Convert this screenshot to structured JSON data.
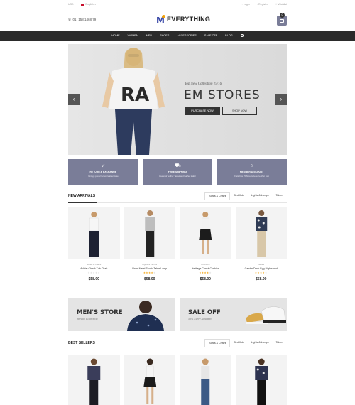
{
  "topbar": {
    "currency": "USD",
    "language": "English",
    "login": "Login",
    "register": "Register",
    "wishlist": "Wishlist"
  },
  "header": {
    "phone": "(01) 158 1468 79",
    "logo_text": "EVERYTHING",
    "cart_count": "0"
  },
  "nav": {
    "items": [
      "HOME",
      "WOMEN",
      "MEN",
      "SHOES",
      "ACCESSORIES",
      "SALE OFF",
      "BLOG"
    ]
  },
  "hero": {
    "tagline": "Top New Collection 15/16",
    "title": "EM STORES",
    "purchase_label": "PURCHASE NOW",
    "shop_label": "SHOP NOW"
  },
  "features": [
    {
      "icon": "rocket-icon",
      "title": "RETURN & EXCHANGE",
      "desc": "Vintage pastel lectum leather case"
    },
    {
      "icon": "car-icon",
      "title": "FREE SHIPPING",
      "desc": "Loafer of leather Tassel and leather loafer"
    },
    {
      "icon": "gift-icon",
      "title": "MEMBER DISCOUNT",
      "desc": "Flats Cus 25 Alina fathered leather loan"
    }
  ],
  "new_arrivals": {
    "title": "NEW ARRIVALS",
    "tabs": [
      "Sofas & Chairs",
      "Bed Kids",
      "Lights & Lamps",
      "Tables"
    ],
    "products": [
      {
        "category": "Sofas & Chairs",
        "name": "Adalar Check Tub Chair",
        "rating": 0,
        "price": "$58.00"
      },
      {
        "category": "Lights & Lamps",
        "name": "Palm Metal Studio Table Lamp",
        "rating": 4,
        "price": "$58.00"
      },
      {
        "category": "Cushions",
        "name": "Heritage Check Cushion",
        "rating": 4,
        "price": "$58.00"
      },
      {
        "category": "Tables",
        "name": "Candle Duck Egg Nightstand",
        "rating": 4,
        "price": "$58.00"
      }
    ]
  },
  "banners": [
    {
      "title": "MEN'S STORE",
      "subtitle": "Special Collection"
    },
    {
      "title": "SALE OFF",
      "subtitle": "50% Every Saturday"
    }
  ],
  "best_sellers": {
    "title": "BEST SELLERS",
    "tabs": [
      "Sofas & Chairs",
      "Bed Kids",
      "Lights & Lamps",
      "Tables"
    ]
  },
  "colors": {
    "accent": "#7a7d98",
    "nav_bg": "#2b2b2b",
    "logo_blue": "#3b4aa8",
    "logo_orange": "#f2a20c",
    "star": "#f2a20c"
  }
}
